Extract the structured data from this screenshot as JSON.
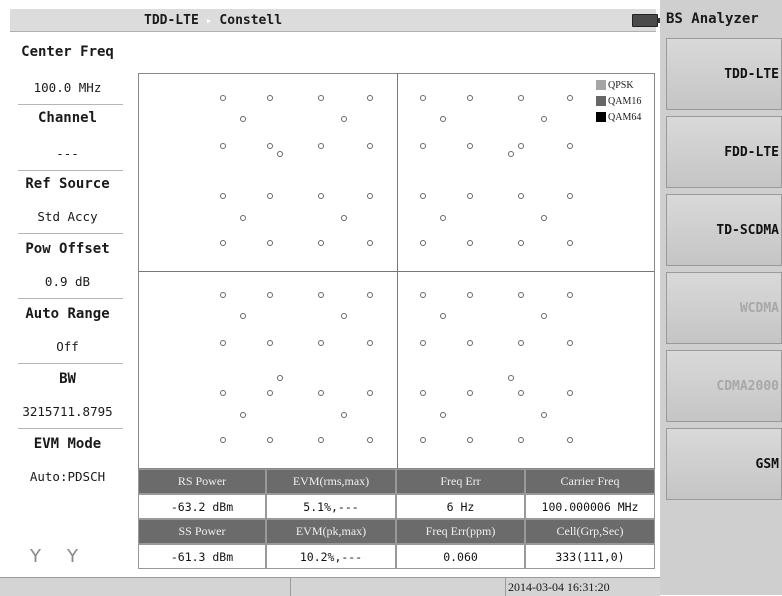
{
  "header": {
    "mode": "TDD-LTE",
    "view": "Constell",
    "separator": "▸"
  },
  "left_panel": {
    "items": [
      {
        "label": "Center Freq",
        "value": "100.0 MHz"
      },
      {
        "label": "Channel",
        "value": "---"
      },
      {
        "label": "Ref Source",
        "value": "Std Accy"
      },
      {
        "label": "Pow Offset",
        "value": "0.9 dB"
      },
      {
        "label": "Auto Range",
        "value": "Off"
      },
      {
        "label": "BW",
        "value": "3215711.8795"
      },
      {
        "label": "EVM Mode",
        "value": "Auto:PDSCH"
      }
    ],
    "antenna_glyph": "Y"
  },
  "legend": [
    {
      "label": "QPSK",
      "color": "#a6a6a6"
    },
    {
      "label": "QAM16",
      "color": "#666666"
    },
    {
      "label": "QAM64",
      "color": "#000000"
    }
  ],
  "measurements": {
    "rows": [
      {
        "headers": [
          "RS Power",
          "EVM(rms,max)",
          "Freq Err",
          "Carrier Freq"
        ],
        "values": [
          "-63.2 dBm",
          "5.1%,---",
          "6 Hz",
          "100.000006 MHz"
        ]
      },
      {
        "headers": [
          "SS Power",
          "EVM(pk,max)",
          "Freq Err(ppm)",
          "Cell(Grp,Sec)"
        ],
        "values": [
          "-61.3 dBm",
          "10.2%,---",
          "0.060",
          "333(111,0)"
        ]
      }
    ]
  },
  "status": {
    "datetime": "2014-03-04 16:31:20"
  },
  "right_panel": {
    "title": "BS Analyzer",
    "keys": [
      {
        "label": "TDD-LTE",
        "enabled": true
      },
      {
        "label": "FDD-LTE",
        "enabled": true
      },
      {
        "label": "TD-SCDMA",
        "enabled": true
      },
      {
        "label": "WCDMA",
        "enabled": false
      },
      {
        "label": "CDMA2000",
        "enabled": false
      },
      {
        "label": "GSM",
        "enabled": true
      }
    ]
  }
}
